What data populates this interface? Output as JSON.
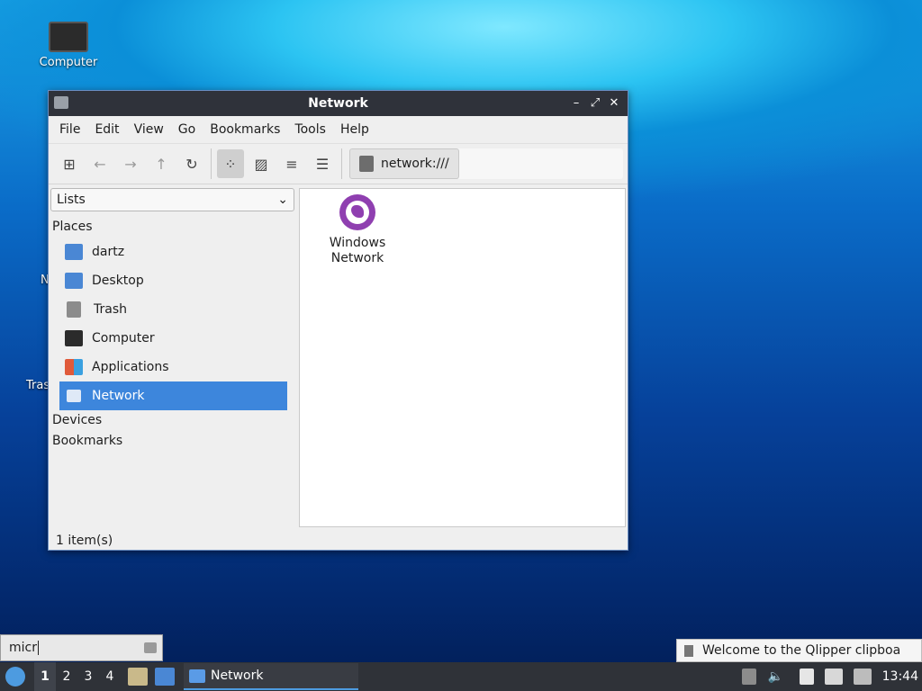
{
  "desktop": {
    "computer_label": "Computer",
    "clipped_labels": [
      "N",
      "Tras"
    ]
  },
  "window": {
    "title": "Network",
    "controls": {
      "minimize": "–",
      "restore": "⤢",
      "close": "✕"
    },
    "menu": [
      "File",
      "Edit",
      "View",
      "Go",
      "Bookmarks",
      "Tools",
      "Help"
    ],
    "address": "network:///",
    "sidebar": {
      "mode": "Lists",
      "places_header": "Places",
      "places": [
        {
          "label": "dartz",
          "icon": "home-folder-icon",
          "color": "#4a87d4"
        },
        {
          "label": "Desktop",
          "icon": "desktop-icon",
          "color": "#4a87d4"
        },
        {
          "label": "Trash",
          "icon": "trash-icon",
          "color": "#8c8c8c"
        },
        {
          "label": "Computer",
          "icon": "computer-icon",
          "color": "#2b2b2b"
        },
        {
          "label": "Applications",
          "icon": "applications-icon",
          "color": "#e05a3a"
        },
        {
          "label": "Network",
          "icon": "network-icon",
          "color": "#4a87d4"
        }
      ],
      "devices_header": "Devices",
      "bookmarks_header": "Bookmarks"
    },
    "content": {
      "items": [
        {
          "line1": "Windows",
          "line2": "Network",
          "icon": "globe-icon",
          "color": "#8f3fb0"
        }
      ]
    },
    "status": "1 item(s)"
  },
  "runner": {
    "value": "micr"
  },
  "notification": {
    "text": "Welcome to the Qlipper clipboa"
  },
  "taskbar": {
    "workspaces": [
      "1",
      "2",
      "3",
      "4"
    ],
    "active_workspace": "1",
    "task_label": "Network",
    "clock": "13:44"
  },
  "colors": {
    "accent": "#3d86dc",
    "titlebar": "#2f323a",
    "taskbar": "#2f3238"
  }
}
